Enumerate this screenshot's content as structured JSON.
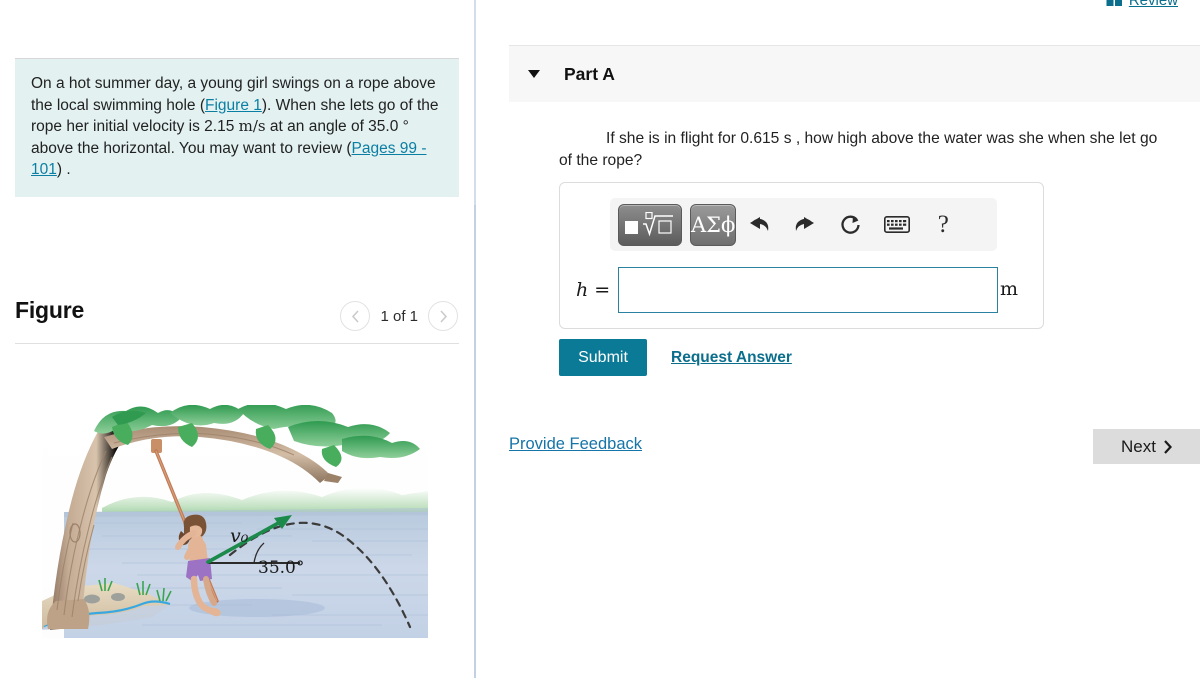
{
  "problem": {
    "text_part1": "On a hot summer day, a young girl swings on a rope above the local swimming hole (",
    "figure_link": "Figure 1",
    "text_part2": "). When she lets go of the rope her initial velocity is 2.15 ",
    "velocity_unit": "m/s",
    "text_part3": " at an angle of 35.0 ",
    "degree_symbol": "°",
    "text_part4": " above the horizontal. You may want to review (",
    "pages_link": "Pages 99 - 101",
    "text_part5": ") ."
  },
  "figure": {
    "title": "Figure",
    "count_label": "1 of 1",
    "prev_icon": "chevron-left-icon",
    "next_icon": "chevron-right-icon",
    "illustration": {
      "velocity_label": "v₀",
      "angle_label": "35.0°",
      "description": "Girl swinging on a rope above a swimming hole with velocity vector and parabolic trajectory",
      "colors": {
        "water": "#c6d4e8",
        "trunk": "#b79a82",
        "foliage": "#3fa35a",
        "sand": "#ded0b6",
        "vector": "#1b8a4a",
        "shorts": "#9b72c4",
        "rope": "#c07b56"
      }
    }
  },
  "review": {
    "label": "Review",
    "icon": "book-icon"
  },
  "part": {
    "title": "Part A",
    "caret_icon": "caret-down-icon",
    "question": "If she is in flight for 0.615 s , how high above the water was she when she let go of the rope?"
  },
  "answer": {
    "variable": "h",
    "equals": "=",
    "value": "",
    "placeholder": "",
    "unit": "m",
    "toolbar": [
      {
        "name": "math-template-button",
        "label": ""
      },
      {
        "name": "greek-symbols-button",
        "label": "ΑΣϕ"
      },
      {
        "name": "undo-button",
        "label": ""
      },
      {
        "name": "redo-button",
        "label": ""
      },
      {
        "name": "reset-button",
        "label": ""
      },
      {
        "name": "keyboard-button",
        "label": ""
      },
      {
        "name": "help-button",
        "label": "?"
      }
    ]
  },
  "actions": {
    "submit_label": "Submit",
    "request_answer_label": "Request Answer",
    "provide_feedback_label": "Provide Feedback",
    "next_label": "Next",
    "next_icon": "chevron-right-icon"
  },
  "colors": {
    "accent_teal": "#0b7a96",
    "link_blue": "#1574a8",
    "problem_bg": "#e3f1f1",
    "part_header_bg": "#f7f7f7",
    "input_border": "#2a82a0"
  }
}
